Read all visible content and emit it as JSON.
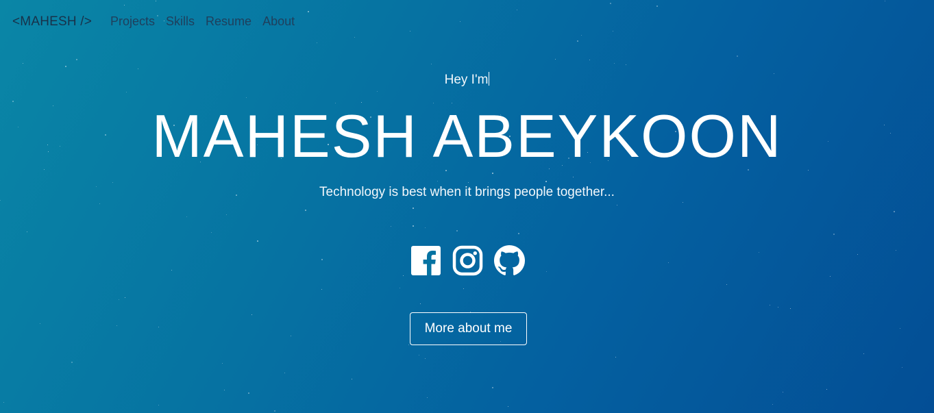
{
  "nav": {
    "brand": "<MAHESH />",
    "links": [
      "Projects",
      "Skills",
      "Resume",
      "About"
    ]
  },
  "hero": {
    "greeting": "Hey I'm",
    "name": "MAHESH ABEYKOON",
    "tagline": "Technology is best when it brings people together..."
  },
  "socials": [
    {
      "icon": "facebook-icon"
    },
    {
      "icon": "instagram-icon"
    },
    {
      "icon": "github-icon"
    }
  ],
  "cta": {
    "label": "More about me"
  },
  "colors": {
    "background_start": "#0a86a6",
    "background_end": "#034e95",
    "nav_text": "#1f3f5c",
    "hero_text": "#ffffff"
  }
}
